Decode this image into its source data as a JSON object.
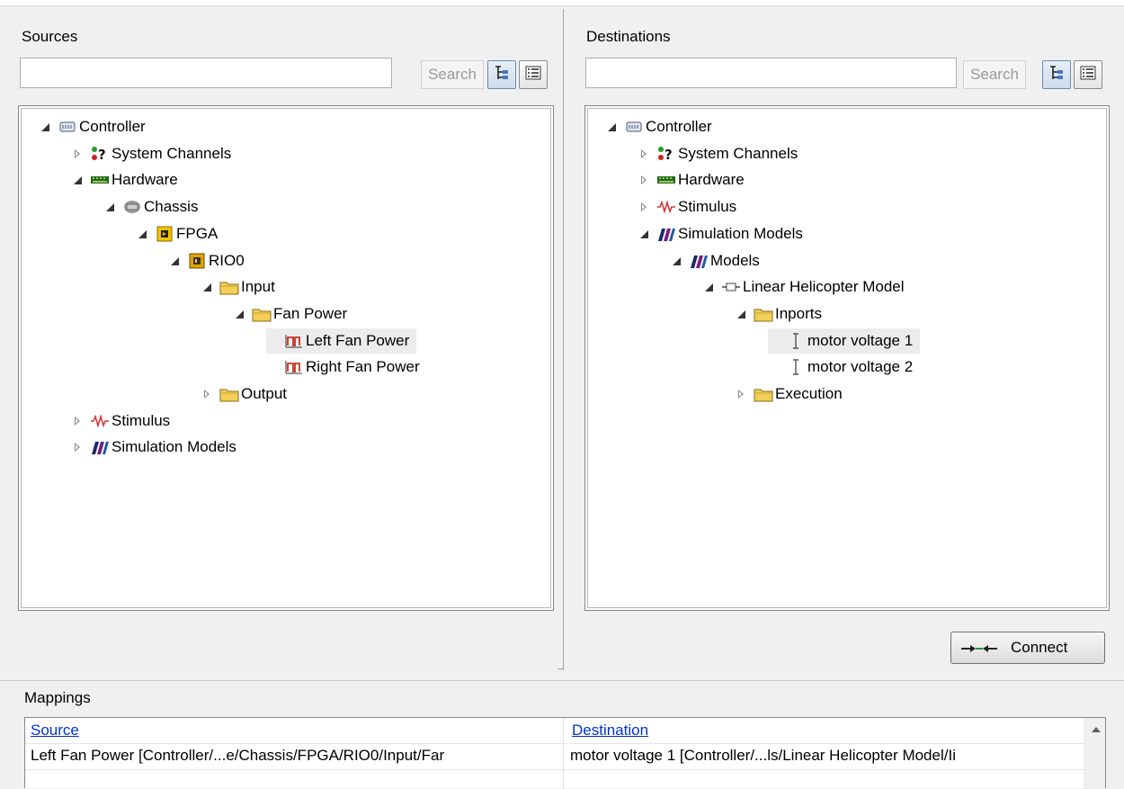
{
  "sources": {
    "title": "Sources",
    "search_value": "",
    "search_label": "Search",
    "tree": [
      {
        "label": "Controller",
        "icon": "controller-icon",
        "toggle": "exp",
        "indent": 0
      },
      {
        "label": "System Channels",
        "icon": "system-channels-icon",
        "toggle": "col",
        "indent": 1
      },
      {
        "label": "Hardware",
        "icon": "hardware-icon",
        "toggle": "exp",
        "indent": 1
      },
      {
        "label": "Chassis",
        "icon": "chassis-icon",
        "toggle": "exp",
        "indent": 2
      },
      {
        "label": "FPGA",
        "icon": "fpga-icon",
        "toggle": "exp",
        "indent": 3
      },
      {
        "label": "RIO0",
        "icon": "rio-icon",
        "toggle": "exp",
        "indent": 4
      },
      {
        "label": "Input",
        "icon": "folder-icon",
        "toggle": "exp",
        "indent": 5
      },
      {
        "label": "Fan Power",
        "icon": "folder-icon",
        "toggle": "exp",
        "indent": 6
      },
      {
        "label": "Left Fan Power",
        "icon": "pwm-channel-icon",
        "toggle": "none",
        "indent": 7,
        "selected": true
      },
      {
        "label": "Right Fan Power",
        "icon": "pwm-channel-icon",
        "toggle": "none",
        "indent": 7
      },
      {
        "label": "Output",
        "icon": "folder-icon",
        "toggle": "col",
        "indent": 5
      },
      {
        "label": "Stimulus",
        "icon": "stimulus-icon",
        "toggle": "col",
        "indent": 1
      },
      {
        "label": "Simulation Models",
        "icon": "simulation-models-icon",
        "toggle": "col",
        "indent": 1
      }
    ]
  },
  "destinations": {
    "title": "Destinations",
    "search_value": "",
    "search_label": "Search",
    "tree": [
      {
        "label": "Controller",
        "icon": "controller-icon",
        "toggle": "exp",
        "indent": 0
      },
      {
        "label": "System Channels",
        "icon": "system-channels-icon",
        "toggle": "col",
        "indent": 1
      },
      {
        "label": "Hardware",
        "icon": "hardware-icon",
        "toggle": "col",
        "indent": 1
      },
      {
        "label": "Stimulus",
        "icon": "stimulus-icon",
        "toggle": "col",
        "indent": 1
      },
      {
        "label": "Simulation Models",
        "icon": "simulation-models-icon",
        "toggle": "exp",
        "indent": 1
      },
      {
        "label": "Models",
        "icon": "models-icon",
        "toggle": "exp",
        "indent": 2
      },
      {
        "label": "Linear Helicopter Model",
        "icon": "model-icon",
        "toggle": "exp",
        "indent": 3
      },
      {
        "label": "Inports",
        "icon": "folder-icon",
        "toggle": "exp",
        "indent": 4
      },
      {
        "label": "motor voltage 1",
        "icon": "inport-icon",
        "toggle": "none",
        "indent": 5,
        "selected": true
      },
      {
        "label": "motor voltage 2",
        "icon": "inport-icon",
        "toggle": "none",
        "indent": 5
      },
      {
        "label": "Execution",
        "icon": "folder-icon",
        "toggle": "col",
        "indent": 4
      }
    ]
  },
  "connect_label": "Connect",
  "mappings": {
    "title": "Mappings",
    "headers": {
      "source": "Source",
      "destination": "Destination"
    },
    "rows": [
      {
        "source": "Left Fan Power [Controller/...e/Chassis/FPGA/RIO0/Input/Far",
        "destination": "motor voltage 1 [Controller/...ls/Linear Helicopter Model/Ii"
      }
    ]
  },
  "colors": {
    "accent": "#0033cc",
    "selection": "#ececec"
  }
}
